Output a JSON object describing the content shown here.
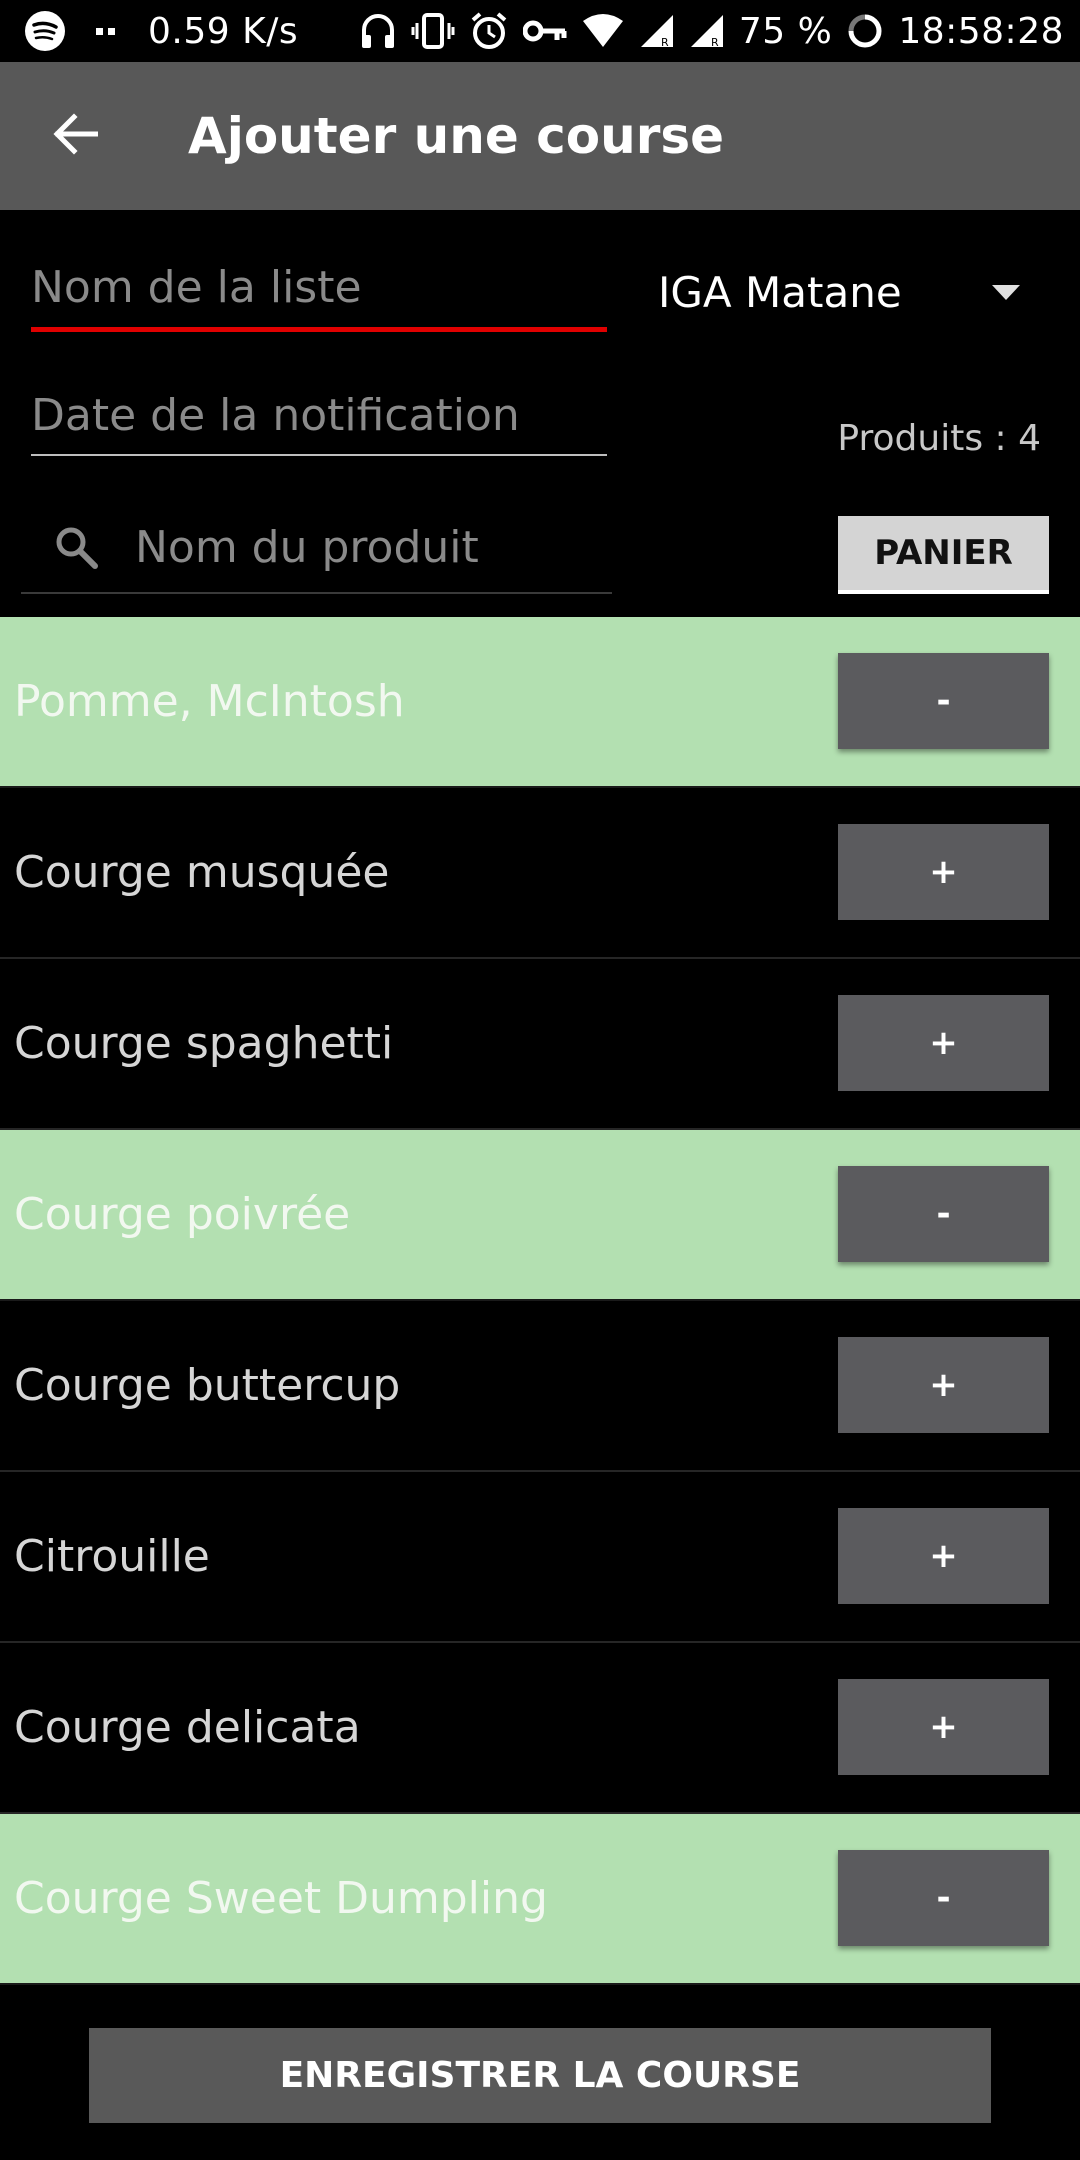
{
  "status_bar": {
    "speed": "0.59 K/s",
    "battery": "75 %",
    "time": "18:58:28",
    "icons": [
      "spotify-icon",
      "dots-icon",
      "headphones-icon",
      "vibrate-icon",
      "alarm-icon",
      "vpn-key-icon",
      "wifi-icon",
      "signal-r-icon",
      "signal-r-icon",
      "battery-ring-icon"
    ]
  },
  "app_bar": {
    "title": "Ajouter une course",
    "back_icon": "arrow-back-icon"
  },
  "form": {
    "list_name": {
      "value": "",
      "placeholder": "Nom de la liste"
    },
    "notification_date": {
      "value": "",
      "placeholder": "Date de la notification"
    },
    "store": {
      "selected": "IGA  Matane"
    },
    "product_count": "Produits : 4",
    "search": {
      "value": "",
      "placeholder": "Nom du produit",
      "icon": "search-icon"
    },
    "panier_label": "PANIER"
  },
  "products": [
    {
      "name": "Pomme, McIntosh",
      "selected": true,
      "action": "-"
    },
    {
      "name": "Courge musquée",
      "selected": false,
      "action": "+"
    },
    {
      "name": "Courge spaghetti",
      "selected": false,
      "action": "+"
    },
    {
      "name": "Courge poivrée",
      "selected": true,
      "action": "-"
    },
    {
      "name": "Courge buttercup",
      "selected": false,
      "action": "+"
    },
    {
      "name": "Citrouille",
      "selected": false,
      "action": "+"
    },
    {
      "name": "Courge delicata",
      "selected": false,
      "action": "+"
    },
    {
      "name": "Courge Sweet Dumpling",
      "selected": true,
      "action": "-"
    }
  ],
  "save_label": "ENREGISTRER LA COURSE",
  "colors": {
    "app_bar": "#585858",
    "selected_row": "#b3e0b1",
    "accent_underline": "#e00000",
    "button": "#5b5b5e"
  }
}
